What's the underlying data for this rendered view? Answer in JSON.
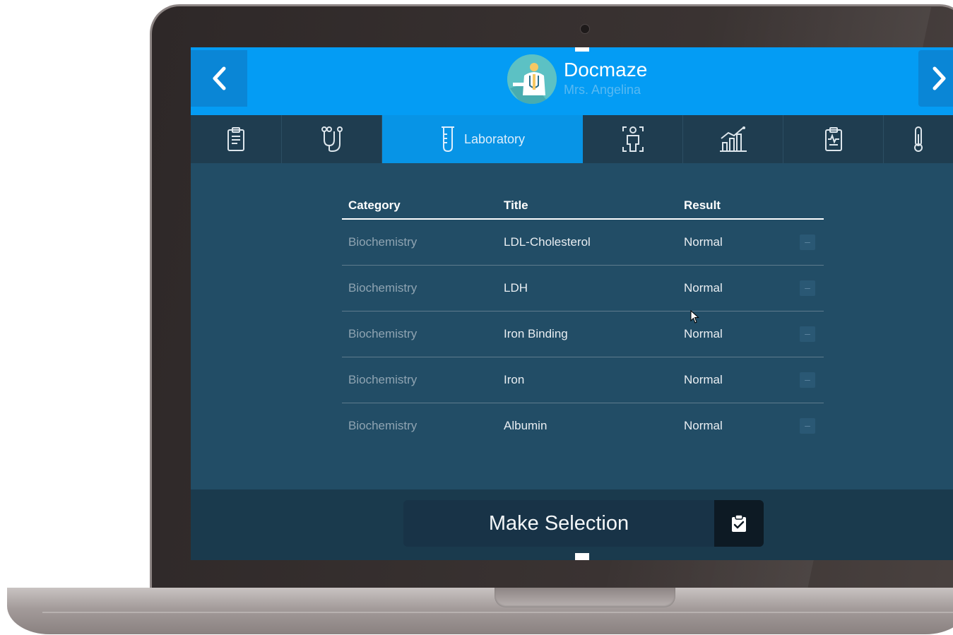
{
  "app": {
    "brand": "Docmaze",
    "patient": "Mrs. Angelina"
  },
  "nav": {
    "prev_icon": "chevron-left-icon",
    "next_icon": "chevron-right-icon"
  },
  "tabs": [
    {
      "icon": "clipboard-notes-icon",
      "label": ""
    },
    {
      "icon": "stethoscope-icon",
      "label": ""
    },
    {
      "icon": "test-tube-icon",
      "label": "Laboratory",
      "active": true
    },
    {
      "icon": "body-scan-icon",
      "label": ""
    },
    {
      "icon": "growth-chart-icon",
      "label": ""
    },
    {
      "icon": "clipboard-pulse-icon",
      "label": ""
    },
    {
      "icon": "thermometer-icon",
      "label": ""
    }
  ],
  "table": {
    "headers": {
      "category": "Category",
      "title": "Title",
      "result": "Result"
    },
    "rows": [
      {
        "category": "Biochemistry",
        "title": "LDL-Cholesterol",
        "result": "Normal",
        "action": "–"
      },
      {
        "category": "Biochemistry",
        "title": "LDH",
        "result": "Normal",
        "action": "–"
      },
      {
        "category": "Biochemistry",
        "title": "Iron Binding",
        "result": "Normal",
        "action": "–"
      },
      {
        "category": "Biochemistry",
        "title": "Iron",
        "result": "Normal",
        "action": "–"
      },
      {
        "category": "Biochemistry",
        "title": "Albumin",
        "result": "Normal",
        "action": "–"
      }
    ]
  },
  "footer": {
    "make_selection": "Make Selection",
    "icon": "clipboard-check-icon"
  },
  "colors": {
    "topbar": "#049cf4",
    "active_tab": "#0794e6",
    "tab_bar": "#1f3d50",
    "content_bg": "#224d66",
    "footer_bg": "#1a3a4d"
  }
}
